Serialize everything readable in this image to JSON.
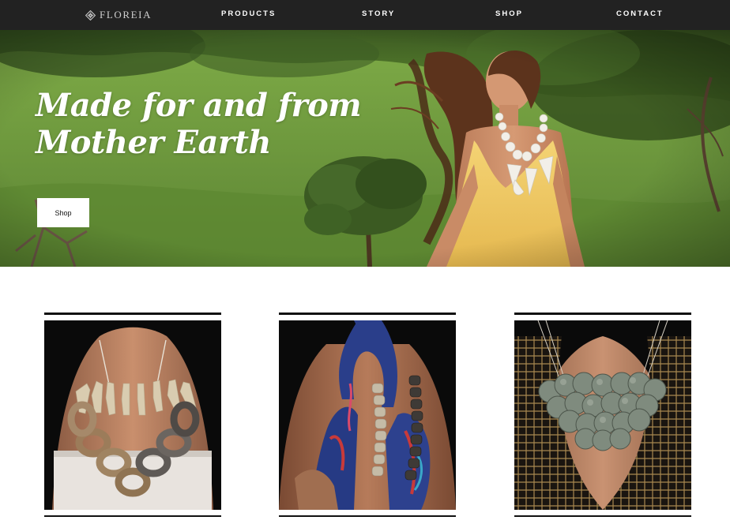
{
  "nav": {
    "logo_text": "FLOREIA",
    "logo_icon": "diamond-lotus-icon",
    "links": [
      "PRODUCTS",
      "STORY",
      "SHOP",
      "CONTACT"
    ]
  },
  "hero": {
    "headline_line1": "Made for and from",
    "headline_line2": "Mother Earth",
    "button_label": "Shop"
  },
  "products": [
    {
      "image": "coral-and-ring-chain-necklace-photo"
    },
    {
      "image": "scarf-and-bead-necklace-photo"
    },
    {
      "image": "silver-disc-bib-necklace-photo"
    }
  ],
  "colors": {
    "nav_bg": "#222222",
    "nav_text": "#ffffff",
    "hero_text": "#ffffff",
    "button_bg": "#ffffff",
    "rule": "#111111"
  }
}
